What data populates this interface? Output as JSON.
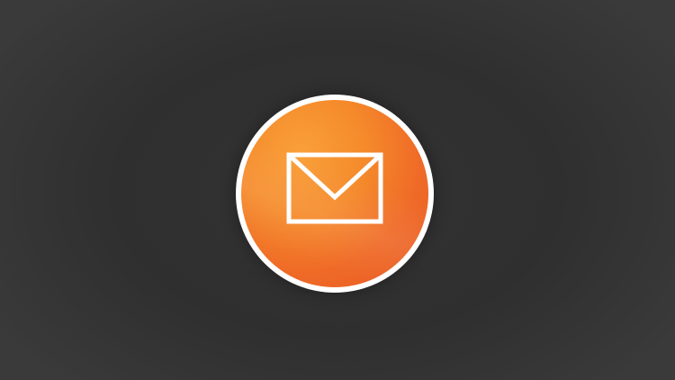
{
  "screen": {
    "background_color": "#333333"
  },
  "badge": {
    "icon": "envelope-icon",
    "ring_color": "#ffffff",
    "fill_color_light": "#f9a03a",
    "fill_color_dark": "#e85a25",
    "icon_color": "#ffffff"
  }
}
